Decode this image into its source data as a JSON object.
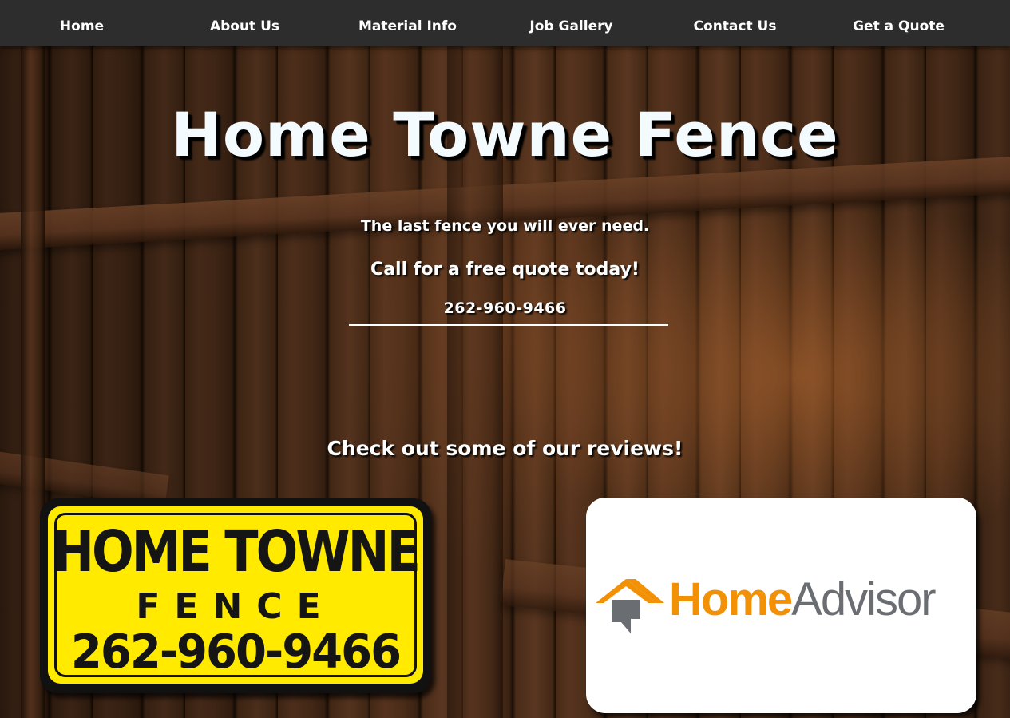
{
  "nav": {
    "items": [
      {
        "label": "Home"
      },
      {
        "label": "About Us"
      },
      {
        "label": "Material Info"
      },
      {
        "label": "Job Gallery"
      },
      {
        "label": "Contact Us"
      },
      {
        "label": "Get a Quote"
      }
    ]
  },
  "hero": {
    "title": "Home Towne Fence",
    "tagline": "The last fence you will ever need.",
    "cta": "Call for a free quote today!",
    "phone": "262-960-9466"
  },
  "reviews": {
    "heading": "Check out some of our reviews!"
  },
  "sign": {
    "line1": "HOME TOWNE",
    "line2": "FENCE",
    "line3": "262-960-9466"
  },
  "home_advisor": {
    "brand_home": "Home",
    "brand_advisor": "Advisor",
    "icon": "homeadvisor-house-icon"
  },
  "colors": {
    "nav_bg": "#2d2d2d",
    "sign_yellow": "#ffea00",
    "homeadvisor_orange": "#f29106",
    "homeadvisor_gray": "#6a6e73"
  }
}
